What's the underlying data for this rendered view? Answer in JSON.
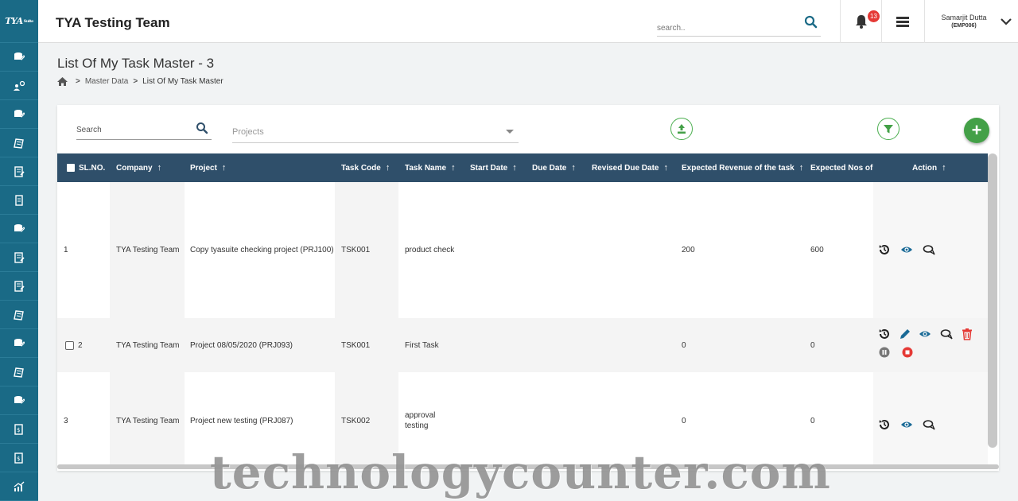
{
  "app": {
    "logo_text": "TYA",
    "logo_small": "Suite",
    "title": "TYA Testing Team"
  },
  "header": {
    "search_placeholder": "search..",
    "notification_count": "13",
    "user_name": "Samarjit Dutta",
    "user_id": "(EMP006)"
  },
  "page": {
    "title": "List Of My Task Master - 3",
    "breadcrumb": [
      "Master Data",
      "List Of My Task Master"
    ]
  },
  "toolbar": {
    "search_placeholder": "Search",
    "projects_placeholder": "Projects",
    "add_label": "+"
  },
  "table": {
    "columns": {
      "sl_no": "SL.NO.",
      "company": "Company",
      "project": "Project",
      "task_code": "Task Code",
      "task_name": "Task Name",
      "start_date": "Start Date",
      "due_date": "Due Date",
      "revised_due_date": "Revised Due Date",
      "expected_revenue": "Expected Revenue of the task",
      "expected_nos": "Expected Nos of h",
      "action": "Action"
    },
    "sort_arrow": "↑",
    "rows": [
      {
        "sl": "1",
        "company": "TYA Testing Team",
        "project": "Copy tyasuite checking project (PRJ100)",
        "task_code": "TSK001",
        "task_name": "product check",
        "start_date": "",
        "due_date": "",
        "revised_due_date": "",
        "expected_revenue": "200",
        "expected_nos": "600"
      },
      {
        "sl": "2",
        "company": "TYA Testing Team",
        "project": "Project 08/05/2020 (PRJ093)",
        "task_code": "TSK001",
        "task_name": "First Task",
        "start_date": "",
        "due_date": "",
        "revised_due_date": "",
        "expected_revenue": "0",
        "expected_nos": "0"
      },
      {
        "sl": "3",
        "company": "TYA Testing Team",
        "project": "Project new testing (PRJ087)",
        "task_code": "TSK002",
        "task_name": "approval testing",
        "start_date": "",
        "due_date": "",
        "revised_due_date": "",
        "expected_revenue": "0",
        "expected_nos": "0"
      }
    ]
  },
  "watermark": "technologycounter.com",
  "colors": {
    "sidebar": "#1a6a86",
    "table_header": "#2f4f6a",
    "accent_green": "#43a047",
    "danger": "#e53935",
    "icon_blue": "#1a6a96"
  }
}
